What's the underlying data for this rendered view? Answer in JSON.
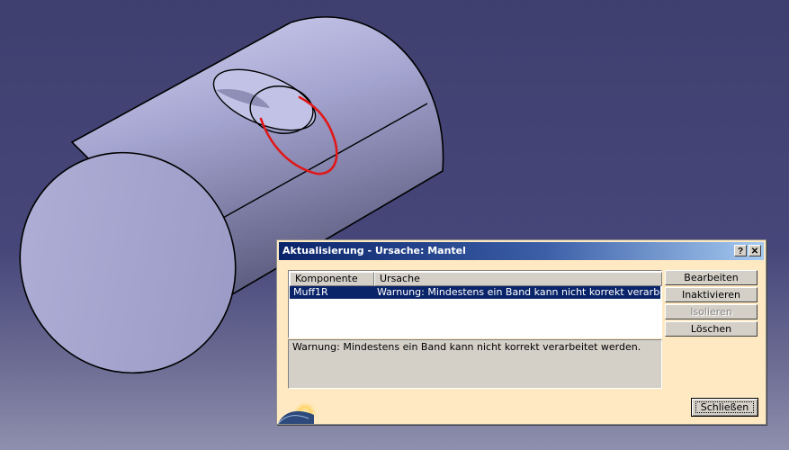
{
  "dialog": {
    "title": "Aktualisierung - Ursache: Mantel",
    "help_label": "?",
    "close_label": "✕",
    "table": {
      "columns": [
        "Komponente",
        "Ursache"
      ],
      "rows": [
        {
          "component": "Muff1R",
          "cause": "Warnung: Mindestens ein Band kann nicht korrekt verarbeit..."
        }
      ]
    },
    "message": "Warnung: Mindestens ein Band kann nicht korrekt verarbeitet werden.",
    "buttons": {
      "edit": "Bearbeiten",
      "deactivate": "Inaktivieren",
      "isolate": "Isolieren",
      "delete": "Löschen",
      "close": "Schließen"
    }
  },
  "colors": {
    "background": "#46467a",
    "cylinder": "#a7a7d4",
    "highlight_curve": "#e01818",
    "dialog_body": "#ffe9c2",
    "selection": "#0a246a"
  }
}
